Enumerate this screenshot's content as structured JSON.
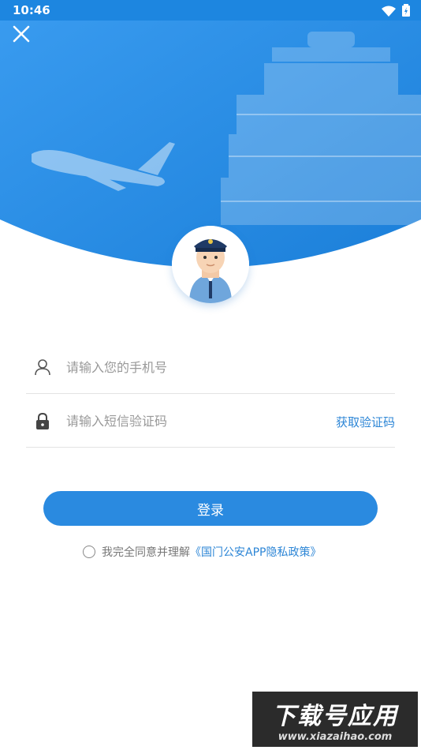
{
  "status_bar": {
    "time": "10:46",
    "icons": [
      "wifi-icon",
      "battery-icon"
    ]
  },
  "header": {
    "close_icon": "close-icon",
    "accent_color": "#1d86e0"
  },
  "form": {
    "phone": {
      "placeholder": "请输入您的手机号",
      "value": "",
      "icon": "user-icon"
    },
    "sms": {
      "placeholder": "请输入短信验证码",
      "value": "",
      "icon": "lock-icon",
      "get_code_label": "获取验证码"
    },
    "login_label": "登录",
    "agreement": {
      "checked": false,
      "text": "我完全同意并理解",
      "link_text": "《国门公安APP隐私政策》"
    }
  },
  "watermark": {
    "title": "下载号应用",
    "url": "www.xiazaihao.com"
  },
  "colors": {
    "primary": "#2a8ae0",
    "link": "#2d86d6",
    "placeholder": "#999999"
  }
}
